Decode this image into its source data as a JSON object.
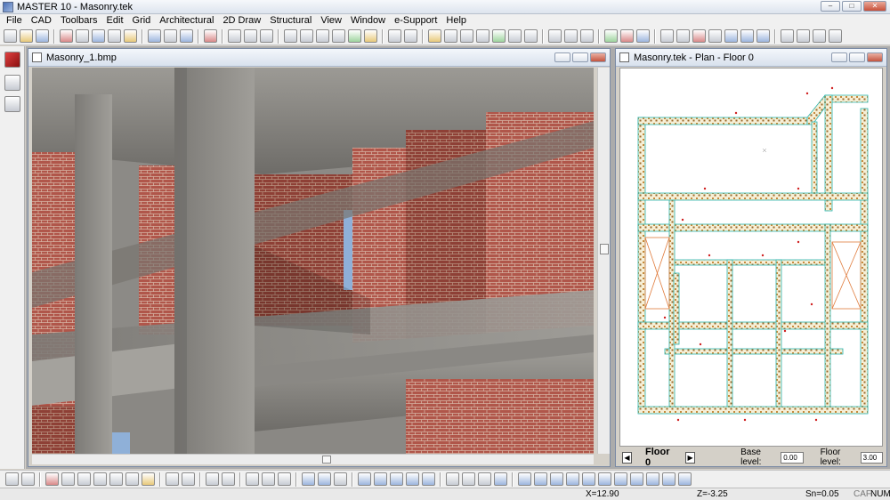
{
  "app": {
    "title": "MASTER 10 - Masonry.tek",
    "window_controls": {
      "minimize": "–",
      "maximize": "□",
      "close": "✕"
    }
  },
  "menu": [
    "File",
    "CAD",
    "Toolbars",
    "Edit",
    "Grid",
    "Architectural",
    "2D Draw",
    "Structural",
    "View",
    "Window",
    "e-Support",
    "Help"
  ],
  "icons": {
    "toolbar_top": [
      "new-file-icon",
      "open-folder-icon",
      "save-icon",
      "print-icon",
      "copy-icon",
      "paste-icon",
      "print-preview-icon",
      "export-icon",
      "pen-icon",
      "layers-icon",
      "grid-icon",
      "line-icon",
      "circle-icon",
      "arc-icon",
      "text-icon",
      "dimension-icon",
      "column-icon",
      "stairs-icon",
      "tools-icon",
      "snap-icon",
      "render-icon"
    ],
    "toolbar_bottom": [
      "undo-icon",
      "redo-icon",
      "alert-icon",
      "zoom-in-icon",
      "zoom-out-icon",
      "zoom-window-icon",
      "zoom-all-icon",
      "pan-icon",
      "measure-icon",
      "beam-icon",
      "slab-icon",
      "wall-icon",
      "text-a-icon",
      "text-m-icon"
    ]
  },
  "render_window": {
    "title": "Masonry_1.bmp"
  },
  "plan_window": {
    "title": "Masonry.tek - Plan - Floor 0",
    "floor_label": "Floor 0",
    "base_level_label": "Base level:",
    "base_level_value": "0.00",
    "floor_level_label": "Floor level:",
    "floor_level_value": "3.00"
  },
  "status": {
    "x": "X=12.90",
    "z": "Z=-3.25",
    "sn": "Sn=0.05",
    "caf": "CAF",
    "num": "NUM"
  },
  "colors": {
    "brick": "#b0564a",
    "concrete": "#8c8a86",
    "plan_wall": "#2ab5b0",
    "plan_label": "#d02020"
  }
}
